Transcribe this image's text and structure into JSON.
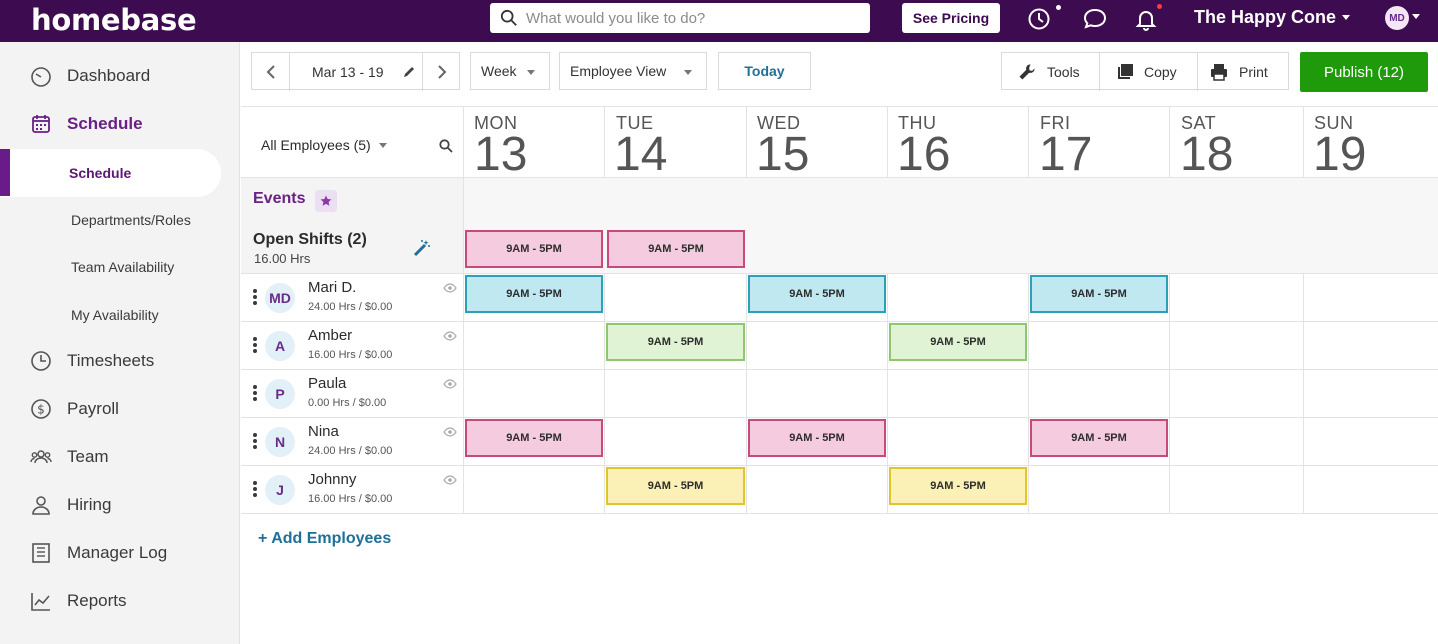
{
  "app": {
    "logo": "homebase"
  },
  "search": {
    "placeholder": "What would you like to do?"
  },
  "header": {
    "see_pricing": "See Pricing",
    "location": "The Happy Cone",
    "user_initials": "MD"
  },
  "sidebar": {
    "items": [
      {
        "label": "Dashboard",
        "icon": "speedometer-icon"
      },
      {
        "label": "Schedule",
        "icon": "calendar-icon",
        "active": true
      },
      {
        "label": "Timesheets",
        "icon": "clock-icon"
      },
      {
        "label": "Payroll",
        "icon": "dollar-icon"
      },
      {
        "label": "Team",
        "icon": "team-icon"
      },
      {
        "label": "Hiring",
        "icon": "person-icon"
      },
      {
        "label": "Manager Log",
        "icon": "book-icon"
      },
      {
        "label": "Reports",
        "icon": "chart-icon"
      }
    ],
    "schedule_subitems": [
      {
        "label": "Schedule",
        "active": true
      },
      {
        "label": "Departments/Roles"
      },
      {
        "label": "Team Availability"
      },
      {
        "label": "My Availability"
      }
    ]
  },
  "toolbar": {
    "date_range": "Mar 13 - 19",
    "period": "Week",
    "view": "Employee View",
    "today": "Today",
    "tools": "Tools",
    "copy": "Copy",
    "print": "Print",
    "publish": "Publish (12)"
  },
  "filter": {
    "label": "All Employees (5)"
  },
  "days": [
    {
      "name": "MON",
      "num": "13"
    },
    {
      "name": "TUE",
      "num": "14"
    },
    {
      "name": "WED",
      "num": "15"
    },
    {
      "name": "THU",
      "num": "16"
    },
    {
      "name": "FRI",
      "num": "17"
    },
    {
      "name": "SAT",
      "num": "18"
    },
    {
      "name": "SUN",
      "num": "19"
    }
  ],
  "events": {
    "label": "Events"
  },
  "open_shifts": {
    "label": "Open Shifts (2)",
    "hours": "16.00 Hrs"
  },
  "shift_label": "9AM - 5PM",
  "employees": [
    {
      "initials": "MD",
      "name": "Mari D.",
      "meta": "24.00 Hrs / $0.00"
    },
    {
      "initials": "A",
      "name": "Amber",
      "meta": "16.00 Hrs / $0.00"
    },
    {
      "initials": "P",
      "name": "Paula",
      "meta": "0.00 Hrs / $0.00"
    },
    {
      "initials": "N",
      "name": "Nina",
      "meta": "24.00 Hrs / $0.00"
    },
    {
      "initials": "J",
      "name": "Johnny",
      "meta": "16.00 Hrs / $0.00"
    }
  ],
  "add_employees": "+ Add Employees",
  "colors": {
    "brand": "#3d0b4f",
    "publish": "#1f9a0a",
    "pink": "#f4cbdf",
    "teal": "#bfe8f0",
    "green": "#e0f3d5",
    "yellow": "#fbf1b6"
  }
}
